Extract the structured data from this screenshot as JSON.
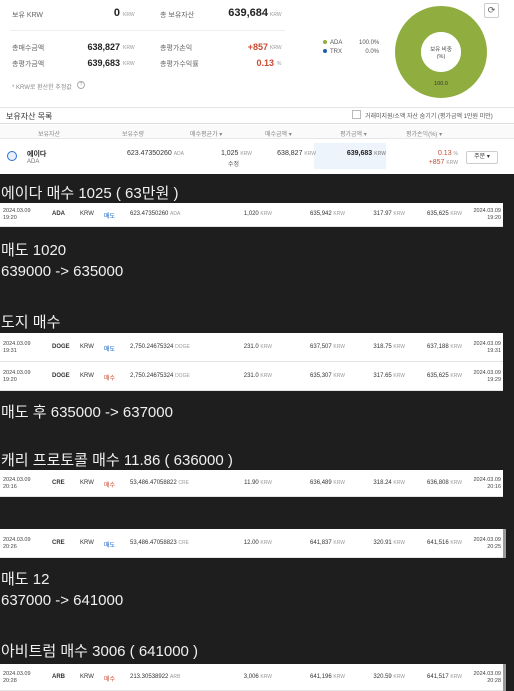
{
  "summary": {
    "holding_krw_label": "보유 KRW",
    "holding_krw_value": "0",
    "total_assets_label": "총 보유자산",
    "total_assets_value": "639,684",
    "total_buy_label": "총매수금액",
    "total_buy_value": "638,827",
    "total_eval_label": "총평가금액",
    "total_eval_value": "639,683",
    "eval_profit_label": "총평가손익",
    "eval_profit_value": "+857",
    "return_label": "총평가수익률",
    "return_value": "0.13",
    "unit_krw": "KRW",
    "unit_pct": "%",
    "note": "* KRW로 환산한 추정값",
    "note_icon": "question-circle-icon"
  },
  "legend": [
    {
      "name": "ADA",
      "pct": "100.0%",
      "color": "#8fae3f"
    },
    {
      "name": "TRX",
      "pct": "0.0%",
      "color": "#1f5fa8"
    }
  ],
  "donut": {
    "center_label": "보유 비중",
    "center_sub": "(%)",
    "slice_label": "100.0",
    "color": "#8fae3f"
  },
  "holdings_section": {
    "title": "보유자산 목록",
    "filter_label": "거래미지원/소액 자산 숨기기 (평가금액 1만원 미만)"
  },
  "holdings_columns": [
    "보유자산",
    "보유수량",
    "매수평균가 ▾",
    "매수금액 ▾",
    "평가금액 ▾",
    "평가손익(%) ▾"
  ],
  "holding": {
    "name": "에이다",
    "symbol": "ADA",
    "qty": "623.47350260",
    "qty_unit": "ADA",
    "avg": "1,025",
    "avg_unit": "KRW",
    "avg_edit": "수정",
    "buy_amt": "638,827",
    "eval_amt": "639,683",
    "pl_pct": "0.13",
    "pl_amt": "+857",
    "order_label": "주문 ▾"
  },
  "headings": {
    "h1": "에이다 매수 1025 ( 63만원 )",
    "h2": "매도 1020",
    "h3": "639000 -> 635000",
    "h4": "도지 매수",
    "h5": "매도 후 635000 -> 637000",
    "h6": "캐리 프로토콜 매수 11.86 ( 636000 )",
    "h7": "매도 12",
    "h8": "637000 -> 641000",
    "h9": "아비트럼 매수 3006 ( 641000 )"
  },
  "trades": [
    {
      "date1": "2024.03.09",
      "time1": "19:20",
      "coin": "ADA",
      "market": "KRW",
      "side": "매도",
      "side_color": "#1261c4",
      "qty": "623.47350260",
      "qty_unit": "ADA",
      "price": "1,020",
      "amount": "635,942",
      "fee": "317.97",
      "settle": "635,625",
      "date2": "2024.03.09",
      "time2": "19:20"
    },
    {
      "date1": "2024.03.09",
      "time1": "19:31",
      "coin": "DOGE",
      "market": "KRW",
      "side": "매도",
      "side_color": "#1261c4",
      "qty": "2,750.24675324",
      "qty_unit": "DOGE",
      "price": "231.0",
      "amount": "637,507",
      "fee": "318.75",
      "settle": "637,188",
      "date2": "2024.03.09",
      "time2": "19:31"
    },
    {
      "date1": "2024.03.09",
      "time1": "19:20",
      "coin": "DOGE",
      "market": "KRW",
      "side": "매수",
      "side_color": "#c84a31",
      "qty": "2,750.24675324",
      "qty_unit": "DOGE",
      "price": "231.0",
      "amount": "635,307",
      "fee": "317.65",
      "settle": "635,625",
      "date2": "2024.03.09",
      "time2": "19:29"
    },
    {
      "date1": "2024.03.09",
      "time1": "20:16",
      "coin": "CRE",
      "market": "KRW",
      "side": "매수",
      "side_color": "#c84a31",
      "qty": "53,486.47058822",
      "qty_unit": "CRE",
      "price": "11.90",
      "amount": "636,489",
      "fee": "318.24",
      "settle": "636,808",
      "date2": "2024.03.09",
      "time2": "20:16"
    },
    {
      "date1": "2024.03.09",
      "time1": "20:26",
      "coin": "CRE",
      "market": "KRW",
      "side": "매도",
      "side_color": "#1261c4",
      "qty": "53,486.47058823",
      "qty_unit": "CRE",
      "price": "12.00",
      "amount": "641,837",
      "fee": "320.91",
      "settle": "641,516",
      "date2": "2024.03.09",
      "time2": "20:25"
    },
    {
      "date1": "2024.03.09",
      "time1": "20:28",
      "coin": "ARB",
      "market": "KRW",
      "side": "매수",
      "side_color": "#c84a31",
      "qty": "213.30538922",
      "qty_unit": "ARB",
      "price": "3,006",
      "amount": "641,196",
      "fee": "320.59",
      "settle": "641,517",
      "date2": "2024.03.09",
      "time2": "20:28"
    }
  ]
}
